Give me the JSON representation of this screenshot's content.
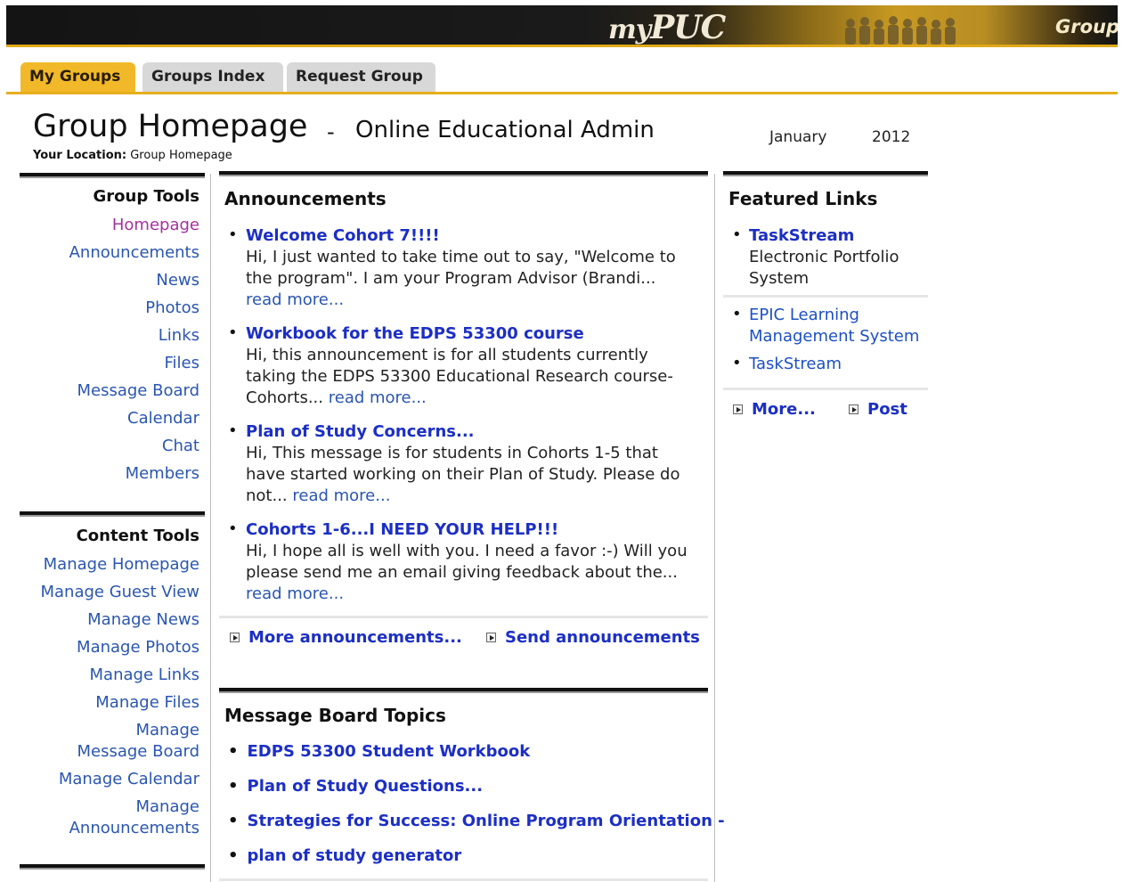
{
  "header": {
    "logo_my": "my",
    "logo_puc": "PUC",
    "groups_label": "Groups"
  },
  "tabs": [
    {
      "label": "My Groups",
      "active": true
    },
    {
      "label": "Groups Index",
      "active": false
    },
    {
      "label": "Request Group",
      "active": false
    }
  ],
  "page": {
    "title": "Group Homepage",
    "separator": "-",
    "group_name": "Online Educational Admin",
    "location_label": "Your Location:",
    "location_value": "Group Homepage",
    "month": "January",
    "year": "2012"
  },
  "sidebar": {
    "group_tools_title": "Group Tools",
    "group_tools": [
      "Homepage",
      "Announcements",
      "News",
      "Photos",
      "Links",
      "Files",
      "Message Board",
      "Calendar",
      "Chat",
      "Members"
    ],
    "content_tools_title": "Content Tools",
    "content_tools": [
      "Manage Homepage",
      "Manage Guest View",
      "Manage News",
      "Manage Photos",
      "Manage Links",
      "Manage Files",
      "Manage Message Board",
      "Manage Calendar",
      "Manage Announcements"
    ]
  },
  "announcements": {
    "title": "Announcements",
    "items": [
      {
        "headline": "Welcome Cohort 7!!!!",
        "line1": "Hi, I just wanted to take time out to say, \"Welcome to",
        "line2": "the program\". I am your Program Advisor (Brandi...",
        "line3": "",
        "read_more": "read more..."
      },
      {
        "headline": "Workbook for the EDPS 53300 course",
        "line1": "Hi, this announcement is for all students currently",
        "line2": "taking the EDPS 53300 Educational Research course-",
        "line3": "Cohorts... ",
        "read_more": "read more..."
      },
      {
        "headline": "Plan of Study Concerns...",
        "line1": "Hi, This message is for students in Cohorts 1-5 that",
        "line2": "have started working on their Plan of Study. Please do",
        "line3": "not... ",
        "read_more": "read more..."
      },
      {
        "headline": "Cohorts 1-6...I NEED YOUR HELP!!!",
        "line1": "Hi, I hope all is well with you. I need a favor :-) Will you",
        "line2": "please send me an email giving feedback about the...",
        "line3": "",
        "read_more": "read more..."
      }
    ],
    "more_label": "More announcements...",
    "send_label": "Send announcements"
  },
  "message_board": {
    "title": "Message Board Topics",
    "topics": [
      "EDPS 53300 Student Workbook",
      "Plan of Study Questions...",
      "Strategies for Success: Online Program Orientation -",
      "plan of study generator"
    ]
  },
  "featured_links": {
    "title": "Featured Links",
    "featured": {
      "name": "TaskStream",
      "desc1": "Electronic Portfolio",
      "desc2": "System"
    },
    "links": [
      {
        "line1": "EPIC Learning",
        "line2": "Management System"
      },
      {
        "line1": "TaskStream",
        "line2": ""
      }
    ],
    "more_label": "More...",
    "post_label": "Post"
  },
  "colors": {
    "accent": "#f1b929",
    "link": "#1c2fc4",
    "current_link": "#a3329c"
  }
}
